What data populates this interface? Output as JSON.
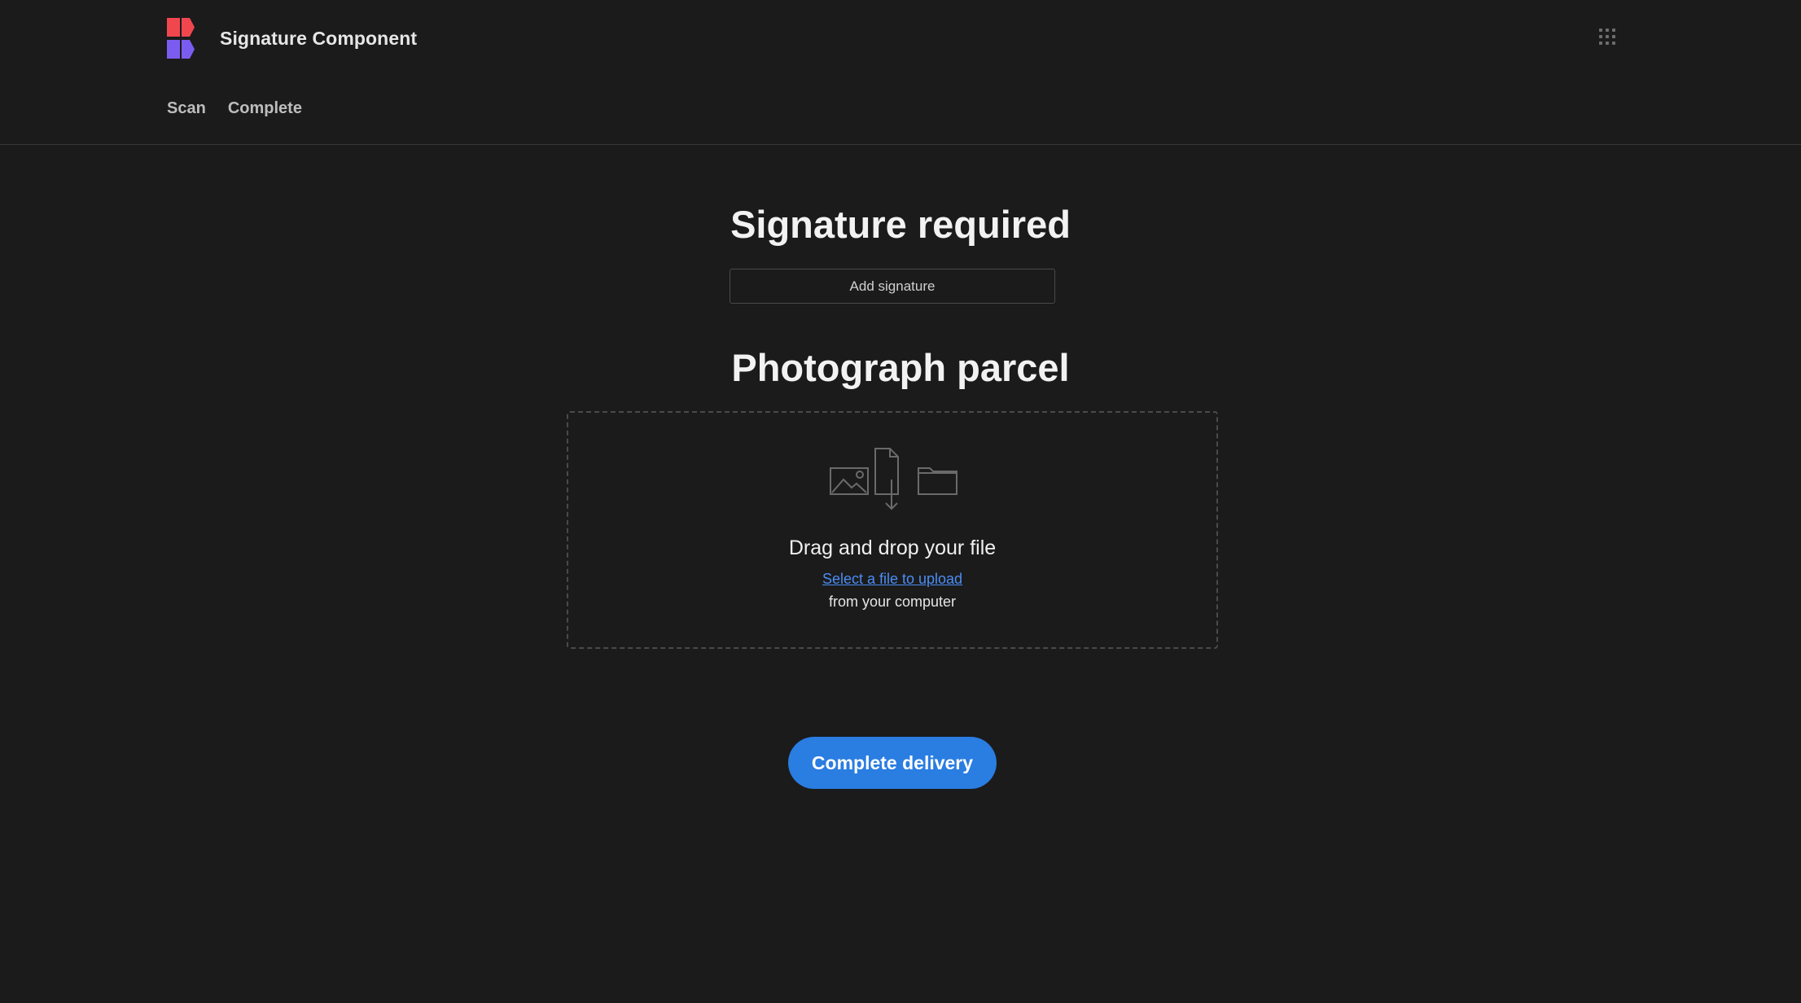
{
  "header": {
    "app_title": "Signature Component",
    "logo_icon": "brand-logo-icon",
    "apps_icon": "app-grid-icon",
    "logo_colors": [
      "#f0474f",
      "#7b5cf0"
    ]
  },
  "nav": {
    "items": [
      {
        "label": "Scan"
      },
      {
        "label": "Complete"
      }
    ]
  },
  "signature": {
    "title": "Signature required",
    "add_button_label": "Add signature"
  },
  "photo": {
    "title": "Photograph parcel",
    "dropzone": {
      "icon": "file-upload-illustration-icon",
      "title": "Drag and drop your file",
      "link_label": "Select a file to upload",
      "subtitle": "from your computer"
    }
  },
  "actions": {
    "complete_label": "Complete delivery",
    "accent_color": "#2a7de1",
    "link_color": "#4b8df5"
  }
}
